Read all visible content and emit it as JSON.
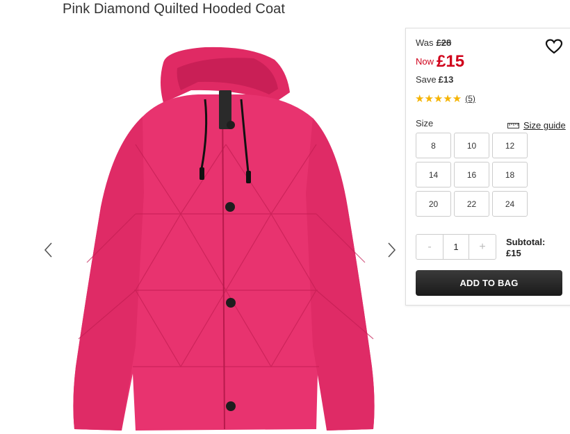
{
  "product": {
    "title": "Pink Diamond Quilted Hooded Coat"
  },
  "pricing": {
    "was_label": "Was",
    "was_price": "£28",
    "now_label": "Now",
    "now_price": "£15",
    "save_label": "Save",
    "save_amount": "£13"
  },
  "rating": {
    "stars": "★★★★★",
    "value": 5,
    "count": "(5)"
  },
  "size": {
    "label": "Size",
    "guide_label": "Size guide",
    "options": [
      "8",
      "10",
      "12",
      "14",
      "16",
      "18",
      "20",
      "22",
      "24"
    ]
  },
  "quantity": {
    "minus": "-",
    "value": "1",
    "plus": "+"
  },
  "subtotal": {
    "label": "Subtotal:",
    "value": "£15"
  },
  "cart": {
    "add_label": "ADD TO BAG"
  },
  "icons": {
    "prev": "chevron-left-icon",
    "next": "chevron-right-icon",
    "wishlist": "heart-icon",
    "ruler": "ruler-icon"
  },
  "colors": {
    "sale_red": "#d0021b",
    "star": "#f5b301",
    "coat_pink": "#e8336f",
    "button_dark": "#222222"
  }
}
